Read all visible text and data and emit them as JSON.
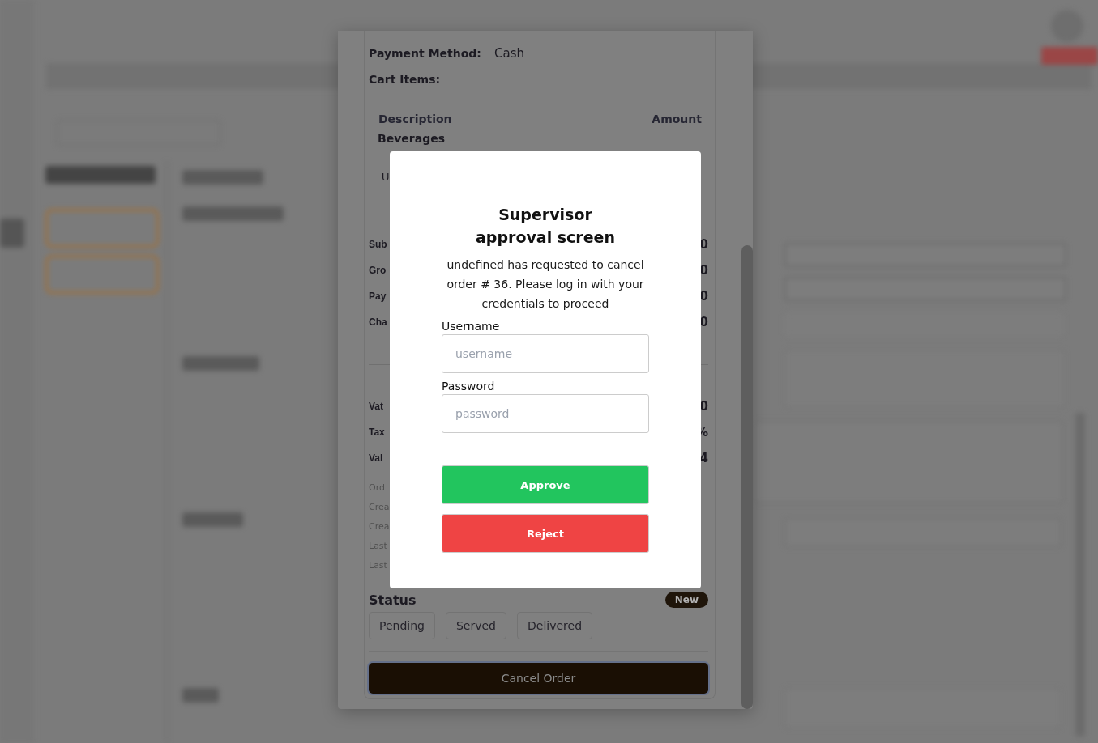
{
  "order_details": {
    "payment_method": {
      "label": "Payment Method:",
      "value": "Cash"
    },
    "cart_items_label": "Cart Items:",
    "columns": [
      "Description",
      "Amount"
    ],
    "category": "Beverages",
    "item_fragment": "U",
    "summary_rows": [
      {
        "label": "Sub",
        "value": "0"
      },
      {
        "label": "Gro",
        "value": "0"
      },
      {
        "label": "Pay",
        "value": "0"
      },
      {
        "label": "Cha",
        "value": "0"
      }
    ],
    "totals_rows": [
      {
        "label": "Vat",
        "value": "0"
      },
      {
        "label": "Tax",
        "value": "%"
      },
      {
        "label": "Val",
        "value": "4"
      }
    ],
    "meta_rows": [
      "Ord",
      "Crea",
      "Crea",
      "Last",
      "Last"
    ],
    "status": {
      "label": "Status",
      "badge": "New"
    },
    "status_buttons": [
      {
        "label": "Pending"
      },
      {
        "label": "Served"
      },
      {
        "label": "Delivered"
      }
    ],
    "cancel_button": "Cancel Order"
  },
  "approval_dialog": {
    "title": "Supervisor approval screen",
    "message": "undefined has requested to cancel order # 36. Please log in with your credentials to proceed",
    "fields": [
      {
        "label": "Username",
        "placeholder": "username"
      },
      {
        "label": "Password",
        "placeholder": "password"
      }
    ],
    "buttons": [
      {
        "label": "Approve",
        "kind": "approve"
      },
      {
        "label": "Reject",
        "kind": "reject"
      }
    ]
  }
}
